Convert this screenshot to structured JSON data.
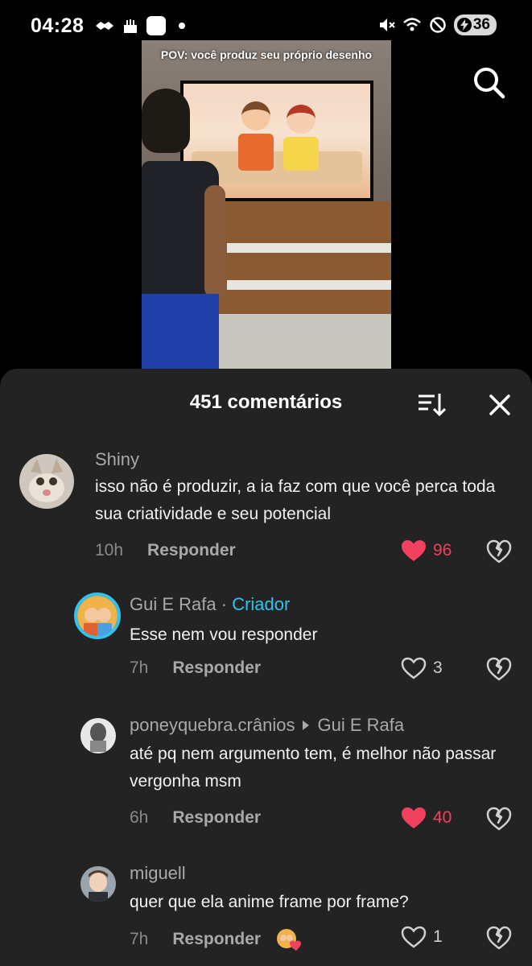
{
  "status_bar": {
    "time": "04:28",
    "battery": "36",
    "left_icons": [
      "handshake-icon",
      "cake-icon",
      "app-icon",
      "dot-icon"
    ],
    "right_icons": [
      "mute-icon",
      "wifi-icon",
      "dnd-icon",
      "battery-icon"
    ]
  },
  "video": {
    "caption": "POV: você produz seu próprio desenho"
  },
  "comments_sheet": {
    "title": "451 comentários",
    "accent_like": "#f1415f",
    "accent_creator": "#2ec4ec",
    "comments": [
      {
        "username": "Shiny",
        "text": "isso não é produzir, a ia faz com que você perca toda sua criatividade e seu potencial",
        "time": "10h",
        "reply_label": "Responder",
        "likes": "96",
        "liked": true
      },
      {
        "username": "Gui E Rafa",
        "separator": "·",
        "badge": "Criador",
        "text": "Esse nem vou responder",
        "time": "7h",
        "reply_label": "Responder",
        "likes": "3",
        "liked": false
      },
      {
        "username": "poneyquebra.crânios",
        "reply_to": "Gui E Rafa",
        "text": "até pq nem argumento tem, é melhor não passar vergonha msm",
        "time": "6h",
        "reply_label": "Responder",
        "likes": "40",
        "liked": true
      },
      {
        "username": "miguell",
        "text": "quer que ela anime frame por frame?",
        "time": "7h",
        "reply_label": "Responder",
        "likes": "1",
        "liked": false
      }
    ]
  }
}
